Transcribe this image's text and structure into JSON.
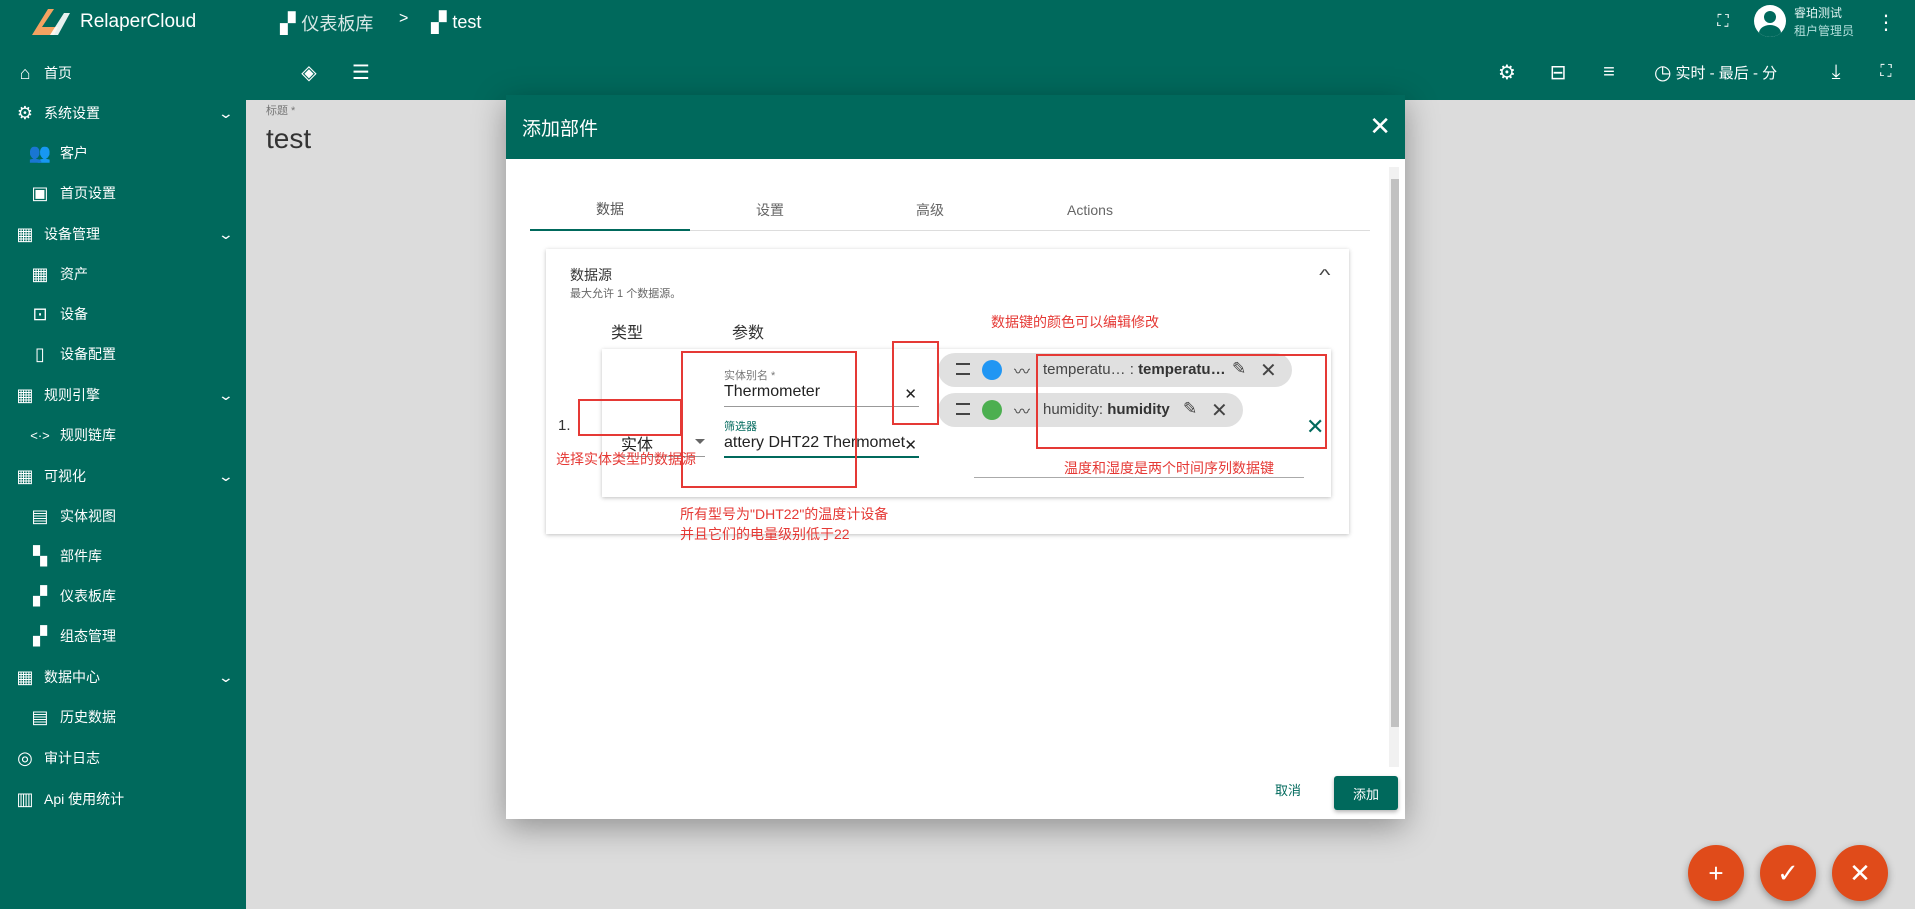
{
  "app": {
    "name": "RelaperCloud"
  },
  "breadcrumb": {
    "dashboards": "仪表板库",
    "sep": ">",
    "current": "test"
  },
  "user": {
    "name": "睿珀测试",
    "role": "租户管理员"
  },
  "toolbar": {
    "timewindow": "实时 - 最后 - 分"
  },
  "sidebar": {
    "items": [
      {
        "label": "首页",
        "icon": "home-icon"
      },
      {
        "label": "系统设置",
        "icon": "gear-icon"
      },
      {
        "label": "客户",
        "icon": "people-icon"
      },
      {
        "label": "首页设置",
        "icon": "settings-box-icon"
      },
      {
        "label": "设备管理",
        "icon": "building-icon"
      },
      {
        "label": "资产",
        "icon": "building-icon"
      },
      {
        "label": "设备",
        "icon": "device-icon"
      },
      {
        "label": "设备配置",
        "icon": "profile-icon"
      },
      {
        "label": "规则引擎",
        "icon": "building-icon"
      },
      {
        "label": "规则链库",
        "icon": "code-icon"
      },
      {
        "label": "可视化",
        "icon": "building-icon"
      },
      {
        "label": "实体视图",
        "icon": "view-icon"
      },
      {
        "label": "部件库",
        "icon": "widgets-icon"
      },
      {
        "label": "仪表板库",
        "icon": "dashboard-icon"
      },
      {
        "label": "组态管理",
        "icon": "dashboard-icon"
      },
      {
        "label": "数据中心",
        "icon": "building-icon"
      },
      {
        "label": "历史数据",
        "icon": "view-icon"
      },
      {
        "label": "审计日志",
        "icon": "track-icon"
      },
      {
        "label": "Api 使用统计",
        "icon": "chart-icon"
      }
    ]
  },
  "page": {
    "title_label": "标题 *",
    "title": "test"
  },
  "dialog": {
    "title": "添加部件",
    "tabs": [
      "数据",
      "设置",
      "高级",
      "Actions"
    ],
    "datasource": {
      "title": "数据源",
      "subtitle": "最大允许 1 个数据源。",
      "col_type": "类型",
      "col_params": "参数",
      "row_index": "1.",
      "type_value": "实体",
      "alias_label": "实体别名 *",
      "alias_value": "Thermometer",
      "filter_label": "筛选器",
      "filter_value": "attery DHT22 Thermomet",
      "keys": [
        {
          "name": "temperatu…",
          "label": "temperatu…",
          "color": "#2196f3"
        },
        {
          "name": "humidity",
          "label": "humidity",
          "color": "#4caf50"
        }
      ]
    },
    "cancel_label": "取消",
    "add_label": "添加"
  },
  "annotations": {
    "type": "选择实体类型的数据源",
    "filter_line1": "所有型号为\"DHT22\"的温度计设备",
    "filter_line2": "并且它们的电量级别低于22",
    "color": "数据键的颜色可以编辑修改",
    "keys": "温度和湿度是两个时间序列数据键"
  }
}
